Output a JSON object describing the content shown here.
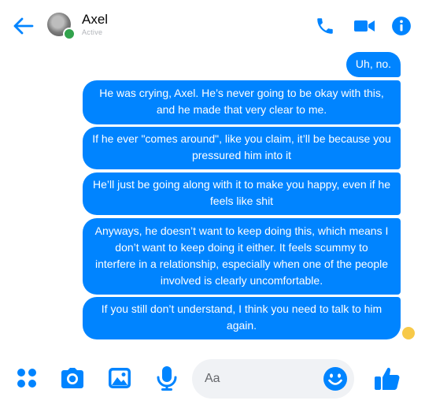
{
  "header": {
    "contact_name": "Axel",
    "status": "Active",
    "icons": [
      "back-arrow-icon",
      "avatar",
      "phone-icon",
      "video-camera-icon",
      "info-icon"
    ]
  },
  "messages": [
    {
      "text": "Uh, no."
    },
    {
      "text": "He was crying, Axel. He’s never going to be okay with this, and he made that very clear to me."
    },
    {
      "text": "If he ever \"comes around\", like you claim, it’ll be because you pressured him into it"
    },
    {
      "text": "He’ll just be going along with it to make you happy, even if he feels like shit"
    },
    {
      "text": "Anyways, he doesn’t want to keep doing this, which means I don’t want to keep doing it either. It feels scummy to interfere in a relationship, especially when one of the people involved is clearly uncomfortable."
    },
    {
      "text": "If you still don’t understand, I think you need to talk to him again."
    }
  ],
  "composer": {
    "placeholder": "Aa",
    "icons": [
      "apps-menu-icon",
      "camera-icon",
      "image-icon",
      "microphone-icon",
      "emoji-icon",
      "thumbs-up-icon"
    ]
  },
  "colors": {
    "accent": "#0084ff",
    "bubble_text": "#ffffff",
    "online": "#31a24c",
    "input_bg": "#f0f2f5"
  }
}
